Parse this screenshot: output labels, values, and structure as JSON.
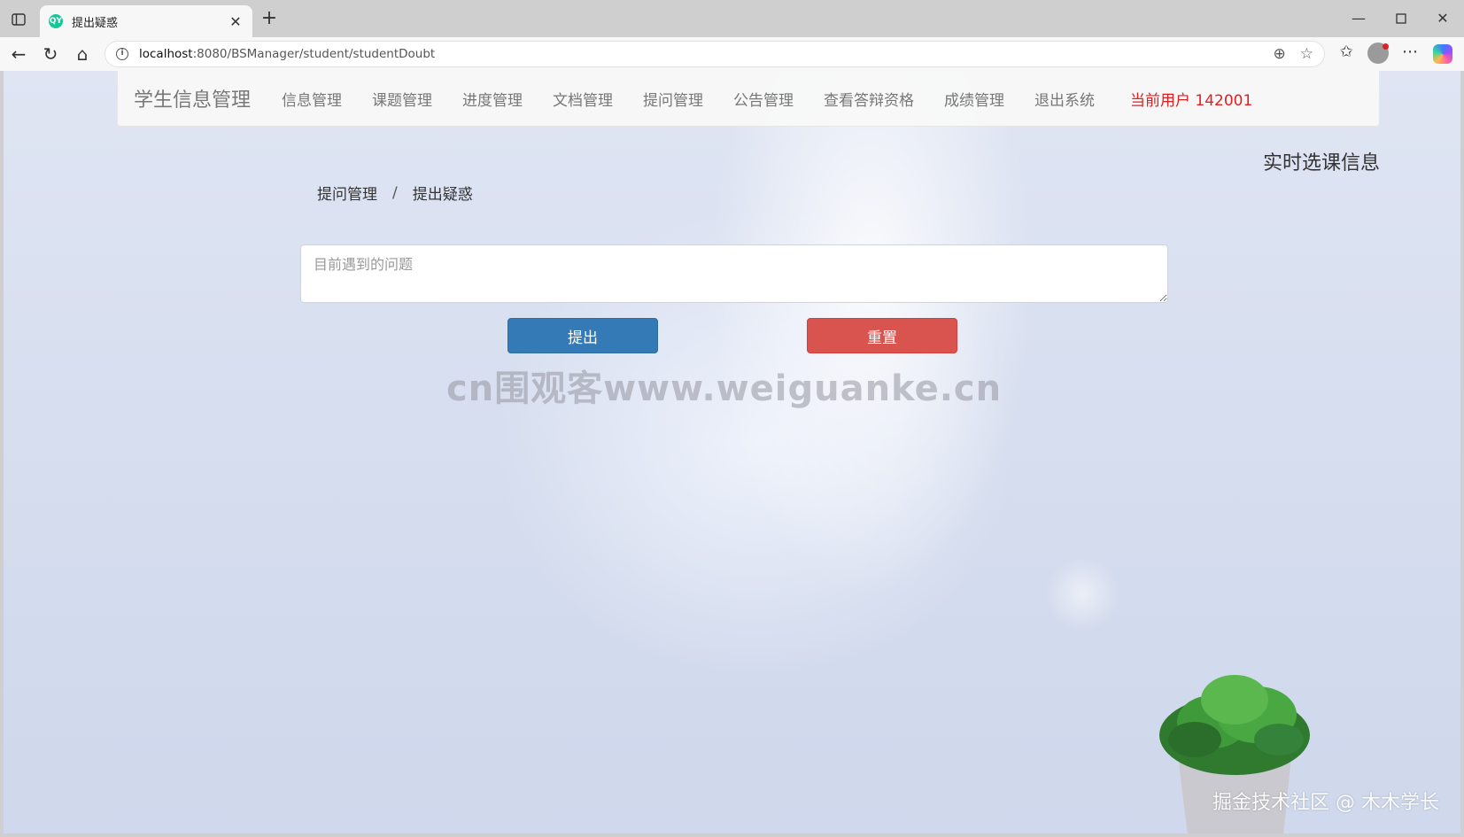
{
  "browser": {
    "tab_title": "提出疑惑",
    "tab_favicon_text": "QY",
    "url_host": "localhost",
    "url_rest": ":8080/BSManager/student/studentDoubt"
  },
  "navbar": {
    "brand": "学生信息管理",
    "items": [
      {
        "label": "信息管理"
      },
      {
        "label": "课题管理"
      },
      {
        "label": "进度管理"
      },
      {
        "label": "文档管理"
      },
      {
        "label": "提问管理"
      },
      {
        "label": "公告管理"
      },
      {
        "label": "查看答辩资格"
      },
      {
        "label": "成绩管理"
      },
      {
        "label": "退出系统"
      }
    ],
    "current_user": "当前用户  142001"
  },
  "side_title": "实时选课信息",
  "breadcrumb": {
    "parent": "提问管理",
    "separator": "/",
    "current": "提出疑惑"
  },
  "form": {
    "question_placeholder": "目前遇到的问题",
    "question_value": "",
    "submit_label": "提出",
    "reset_label": "重置"
  },
  "watermarks": {
    "center": "cn围观客www.weiguanke.cn",
    "bottom": "掘金技术社区 @ 木木学长"
  },
  "colors": {
    "submit": "#337ab7",
    "reset": "#d9534f",
    "user": "#e02020"
  }
}
